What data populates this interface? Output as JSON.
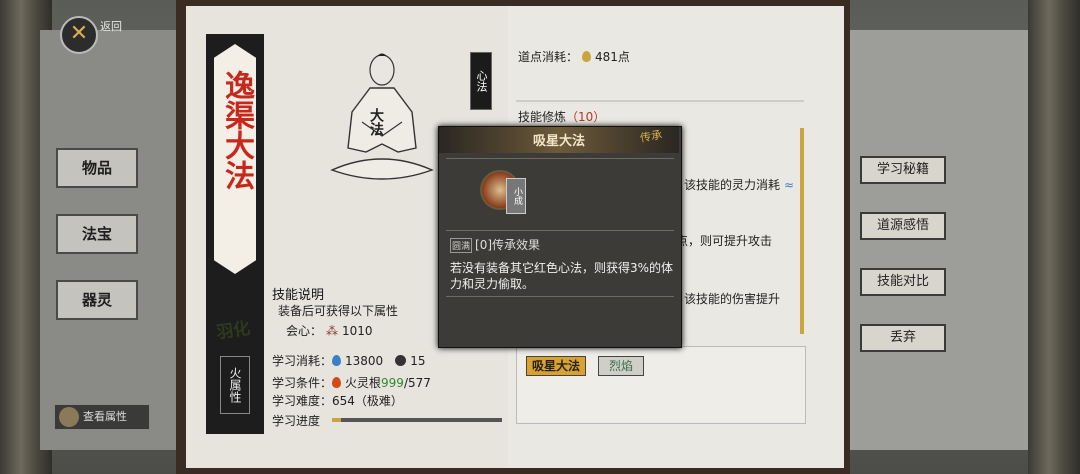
{
  "nav": {
    "back_label": "返回",
    "back_icon": "close-x-icon",
    "items": [
      {
        "label": "物品"
      },
      {
        "label": "法宝"
      },
      {
        "label": "器灵"
      }
    ],
    "view_attr": "查看属性"
  },
  "book": {
    "title": "逸渠大法",
    "badge": "心法",
    "figure_label": "大法",
    "element_label": "羽化",
    "attr_label": "火属性",
    "desc_heading": "技能说明",
    "desc_text": "装备后可获得以下属性",
    "stat_name": "会心：",
    "stat_value": "1010",
    "cost_label": "学习消耗：",
    "cost_water": "13800",
    "cost_stone": "15",
    "req_label": "学习条件：",
    "req_name": "火灵根",
    "req_have": "999",
    "req_need": "/577",
    "difficulty_label": "学习难度：",
    "difficulty_value": "654（极难）",
    "progress_label": "学习进度",
    "progress_fraction": 0.05
  },
  "right_page": {
    "points_label": "道点消耗：",
    "points_value": "481点",
    "train_label": "技能修炼",
    "train_value": "（10）",
    "line1": "该技能的灵力消耗",
    "line2": "点，则可提升攻击",
    "line3": "该技能的伤害提升",
    "tabs": [
      {
        "label": "吸星大法"
      },
      {
        "label": "烈焰"
      }
    ]
  },
  "popup": {
    "title": "吸星大法",
    "tag": "传承",
    "grade": "小成",
    "effect_badge": "圆满",
    "effect_title": "[0]传承效果",
    "effect_desc": "若没有装备其它红色心法，则获得3%的体力和灵力偷取。"
  },
  "side_buttons": [
    {
      "label": "学习秘籍"
    },
    {
      "label": "道源感悟"
    },
    {
      "label": "技能对比"
    },
    {
      "label": "丢弃"
    }
  ],
  "colors": {
    "accent_gold": "#d9a12e",
    "title_red": "#c8281c",
    "req_green": "#2f8a2f"
  }
}
